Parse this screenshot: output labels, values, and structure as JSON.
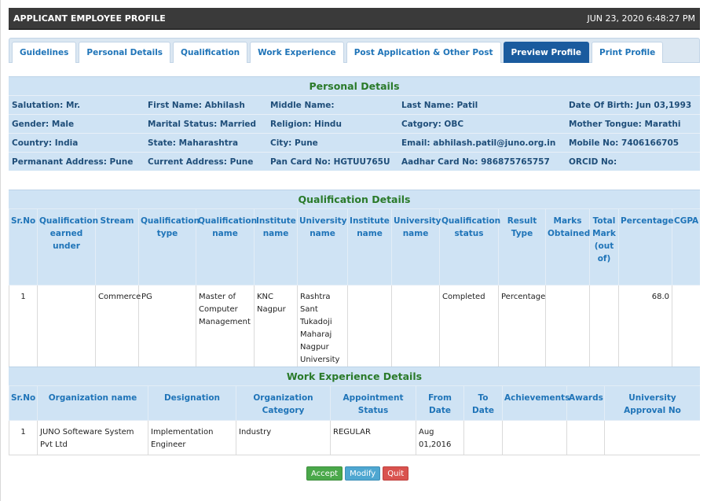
{
  "header": {
    "title": "APPLICANT EMPLOYEE PROFILE",
    "datetime": "JUN 23, 2020  6:48:27 PM"
  },
  "tabs": [
    {
      "label": "Guidelines",
      "active": false
    },
    {
      "label": "Personal Details",
      "active": false
    },
    {
      "label": "Qualification",
      "active": false
    },
    {
      "label": "Work Experience",
      "active": false
    },
    {
      "label": "Post Application & Other Post",
      "active": false
    },
    {
      "label": "Preview Profile",
      "active": true
    },
    {
      "label": "Print Profile",
      "active": false
    }
  ],
  "personal": {
    "title": "Personal Details",
    "rows": [
      [
        "Salutation: Mr.",
        "First Name: Abhilash",
        "Middle Name:",
        "Last Name: Patil",
        "Date Of Birth: Jun 03,1993"
      ],
      [
        "Gender: Male",
        "Marital Status: Married",
        "Religion: Hindu",
        "Catgory: OBC",
        "Mother Tongue: Marathi"
      ],
      [
        "Country: India",
        "State: Maharashtra",
        "City: Pune",
        "Email: abhilash.patil@juno.org.in",
        "Mobile No: 7406166705"
      ],
      [
        "Permanant Address: Pune",
        "Current Address: Pune",
        "Pan Card No: HGTUU765U",
        "Aadhar Card No: 986875765757",
        "ORCID No:"
      ]
    ]
  },
  "qualification": {
    "title": "Qualification Details",
    "headers": [
      "Sr.No",
      "Qualification earned under",
      "Stream",
      "Qualification type",
      "Qualification name",
      "Institute name",
      "University name",
      "Institute name",
      "University name",
      "Qualification status",
      "Result Type",
      "Marks Obtained",
      "Total Mark (out of)",
      "Percentage",
      "CGPA"
    ],
    "rows": [
      [
        "1",
        "",
        "Commerce",
        "PG",
        "Master of Computer Management",
        "KNC Nagpur",
        "Rashtra Sant Tukadoji Maharaj Nagpur University",
        "",
        "",
        "Completed",
        "Percentage",
        "",
        "",
        "68.0",
        ""
      ]
    ]
  },
  "work": {
    "title": "Work Experience Details",
    "headers": [
      "Sr.No",
      "Organization name",
      "Designation",
      "Organization Category",
      "Appointment Status",
      "From Date",
      "To Date",
      "Achievements",
      "Awards",
      "University Approval No"
    ],
    "rows": [
      [
        "1",
        "JUNO Softeware System Pvt Ltd",
        "Implementation Engineer",
        "Industry",
        "REGULAR",
        "Aug 01,2016",
        "",
        "",
        "",
        ""
      ]
    ]
  },
  "buttons": {
    "accept": "Accept",
    "modify": "Modify",
    "quit": "Quit"
  }
}
